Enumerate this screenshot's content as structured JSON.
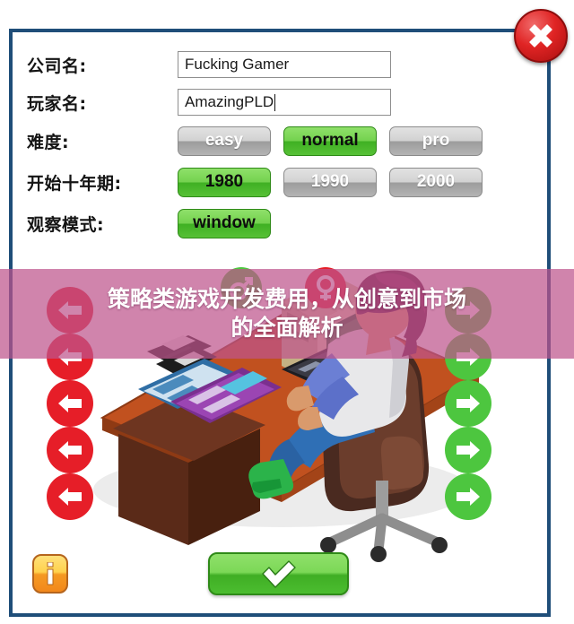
{
  "window": {
    "border_color": "#1f4e79",
    "background": "#ffffff"
  },
  "close_button": {
    "icon": "close-x-icon",
    "color": "#e02424"
  },
  "form": {
    "fields": [
      {
        "label": "公司名:",
        "value": "Fucking Gamer",
        "placeholder": "",
        "has_caret": false
      },
      {
        "label": "玩家名:",
        "value": "AmazingPLD",
        "placeholder": "",
        "has_caret": true
      }
    ],
    "difficulty": {
      "label": "难度:",
      "options": [
        {
          "text": "easy",
          "selected": false
        },
        {
          "text": "normal",
          "selected": true
        },
        {
          "text": "pro",
          "selected": false
        }
      ]
    },
    "start_decade": {
      "label": "开始十年期:",
      "options": [
        {
          "text": "1980",
          "selected": true
        },
        {
          "text": "1990",
          "selected": false
        },
        {
          "text": "2000",
          "selected": false
        }
      ]
    },
    "view_mode": {
      "label": "观察模式:",
      "options": [
        {
          "text": "window",
          "selected": true
        }
      ]
    }
  },
  "gender": {
    "male": {
      "icon": "male-gender-icon",
      "color": "#4dc63f",
      "glyph": "♂"
    },
    "female": {
      "icon": "female-gender-icon",
      "color": "#e61e28",
      "glyph": "♀"
    }
  },
  "arrows": {
    "left": {
      "icon": "arrow-left-icon",
      "color": "#e61e28",
      "count": 5
    },
    "right": {
      "icon": "arrow-right-icon",
      "color": "#4dc63f",
      "count": 5
    }
  },
  "banner": {
    "line1": "策略类游戏开发费用，从创意到市场",
    "line2": "的全面解析",
    "background": "#be558c"
  },
  "bottom_bar": {
    "info_button": {
      "icon": "info-icon",
      "label": "i",
      "color": "#f59a23"
    },
    "confirm_button": {
      "icon": "check-icon",
      "color": "#4cbd30"
    }
  },
  "illustration": {
    "name": "developer-at-desk-illustration",
    "desk_color": "#b8471f",
    "desk_side_color": "#5a2a18"
  }
}
